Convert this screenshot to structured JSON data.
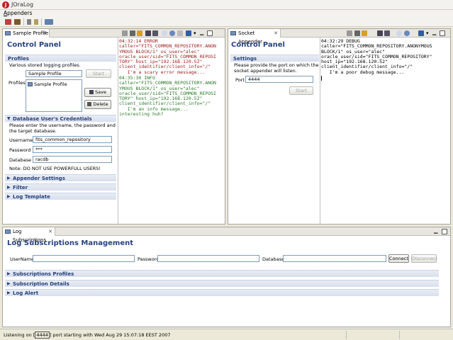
{
  "window": {
    "title": "JOraLog"
  },
  "menu": {
    "appenders": "Appenders"
  },
  "left_pane": {
    "tab_label": "Sample Profile",
    "control_panel_title": "Control Panel",
    "profiles_header": "Profiles",
    "profiles_desc": "Various stored logging profiles.",
    "profile_name_value": "Sample Profile",
    "start_label": "Start",
    "profiles_label": "Profiles",
    "profile_list": [
      "Sample Profile"
    ],
    "save_label": "Save",
    "delete_label": "Delete",
    "db_header": "Database User's Credentials",
    "db_desc": "Please enter the username, the password and the target database.",
    "username_label": "Username",
    "username_value": "fits_common_repository",
    "password_label": "Password",
    "password_value": "***",
    "database_label": "Database",
    "database_value": "racdb",
    "note": "Note: DO NOT USE POWERFULL USERS!",
    "sections": [
      "Appender Settings",
      "Filter",
      "Log Template"
    ],
    "log_error": "04:32:14 ERROR\ncaller=\"FITS_COMMON_REPOSITORY.ANON\nYMOUS BLOCK/1\" os_user=\"alec\"\noracle_user/sid=\"FITS_COMMON_REPOSI\nTORY\" host_ip=\"192.168.120.52\"\nclient_identifier/client_info=\"/\"\n   I'm a scary error message...",
    "log_info": "04:35:30 INFO\ncaller=\"FITS_COMMON_REPOSITORY.ANON\nYMOUS BLOCK/1\" os_user=\"alec\"\noracle_user/sid=\"FITS_COMMON_REPOSI\nTORY\" host_ip=\"192.168.120.52\"\nclient_identifier/client_info=\"/\"\n   I'm an info message...\ninteresting huh?"
  },
  "right_pane": {
    "tab_label": "Socket Appender",
    "control_panel_title": "Control Panel",
    "settings_header": "Settings",
    "settings_desc": "Please provide the port on which the socket appender will listen.",
    "port_label": "Port",
    "port_value": "4444",
    "start_label": "Start",
    "log_debug": "04:32:29 DEBUG\ncaller=\"FITS_COMMON_REPOSITORY.ANONYMOUS\nBLOCK/1\" os_user=\"alec\"\noracle_user/sid=\"FITS_COMMON_REPOSITORY\"\nhost_ip=\"192.168.120.52\"\nclient_identifier/client_info=\"/\"\n   I'm a poor debug message..."
  },
  "bottom_pane": {
    "tab_label": "Log Subscriptions",
    "title": "Log Subscriptions Management",
    "username_label": "UserName",
    "password_label": "Password",
    "database_label": "Database",
    "connect_label": "Connect",
    "disconnect_label": "Disconnect",
    "sections": [
      "Subscriptions Profiles",
      "Subscription Details",
      "Log Alert"
    ]
  },
  "status": {
    "prefix": "Listening on [",
    "port": "4444",
    "suffix": "] port starting with Wed Aug 29 15:07:18 EEST 2007"
  }
}
